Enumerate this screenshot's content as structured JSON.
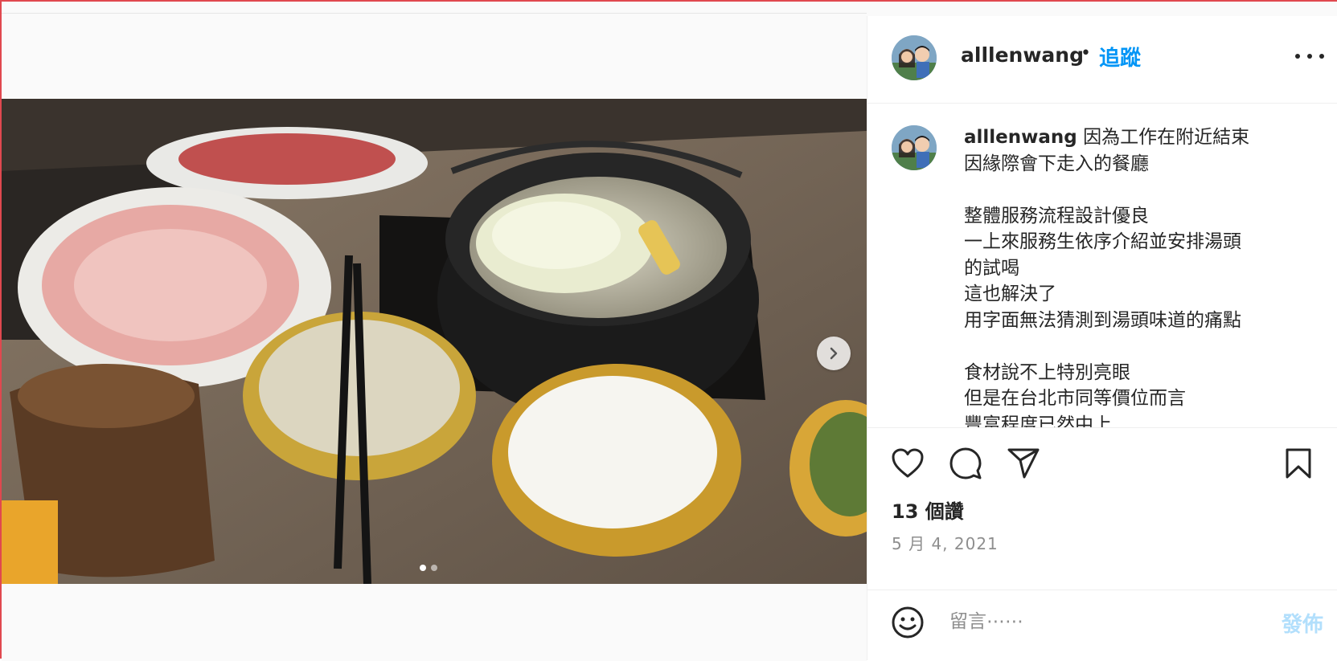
{
  "post": {
    "image_description_alt": "",
    "carousel": {
      "current": 1,
      "total": 2
    }
  },
  "header": {
    "username": "alllenwang",
    "separator": "•",
    "follow_label": "追蹤"
  },
  "caption": {
    "username": "alllenwang",
    "first_line": " 因為工作在附近結束",
    "lines": [
      "因緣際會下走入的餐廳",
      "",
      "整體服務流程設計優良",
      "一上來服務生依序介紹並安排湯頭",
      "的試喝",
      "這也解決了",
      "用字面無法猜測到湯頭味道的痛點",
      "",
      "食材說不上特別亮眼",
      "但是在台北市同等價位而言",
      "豐富程度已然中上"
    ]
  },
  "stats": {
    "likes": "13 個讚",
    "date": "5 月 4, 2021"
  },
  "comment": {
    "placeholder": "留言⋯⋯",
    "post_label": "發佈"
  },
  "icons": {
    "like": "heart-icon",
    "comment": "comment-icon",
    "share": "paper-plane-icon",
    "save": "bookmark-icon",
    "emoji": "smiley-icon",
    "more": "more-options-icon",
    "next": "chevron-right-icon"
  },
  "colors": {
    "accent": "#0095f6",
    "post_disabled": "#b2dffc",
    "muted": "#8e8e8e"
  }
}
